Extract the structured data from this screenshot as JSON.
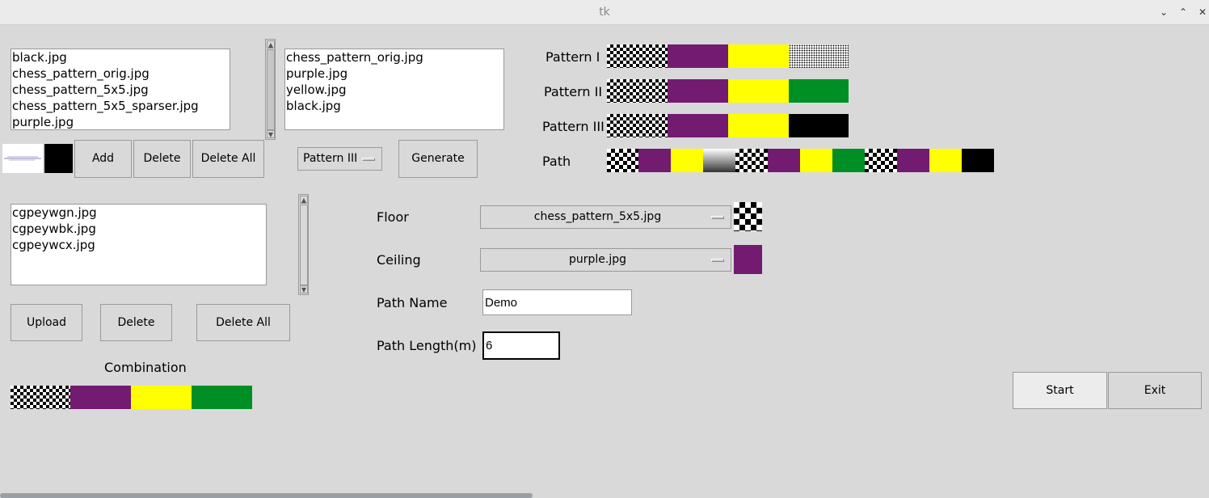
{
  "window": {
    "title": "tk",
    "controls": {
      "minimize_icon": "chevron-down-icon",
      "maximize_icon": "chevron-up-icon",
      "close_icon": "close-icon"
    }
  },
  "image_list": {
    "items": [
      "black.jpg",
      "chess_pattern_orig.jpg",
      "chess_pattern_5x5.jpg",
      "chess_pattern_5x5_sparser.jpg",
      "purple.jpg"
    ]
  },
  "selected_list": {
    "items": [
      "chess_pattern_orig.jpg",
      "purple.jpg",
      "yellow.jpg",
      "black.jpg"
    ]
  },
  "image_controls": {
    "add_label": "Add",
    "delete_label": "Delete",
    "delete_all_label": "Delete All"
  },
  "pattern_select": {
    "value": "Pattern III"
  },
  "generate_label": "Generate",
  "patterns": [
    {
      "label": "Pattern I",
      "swatches": [
        "chess-orig",
        "purple",
        "yellow",
        "dots"
      ]
    },
    {
      "label": "Pattern II",
      "swatches": [
        "chess-orig",
        "purple",
        "yellow",
        "green"
      ]
    },
    {
      "label": "Pattern III",
      "swatches": [
        "chess-orig",
        "purple",
        "yellow",
        "black"
      ]
    }
  ],
  "path": {
    "label": "Path",
    "swatches": [
      "chess",
      "purple",
      "yellow",
      "dots-fade",
      "chess",
      "purple",
      "yellow",
      "green",
      "chess",
      "purple",
      "yellow",
      "black"
    ]
  },
  "upload_list": {
    "items": [
      "cgpeywgn.jpg",
      "cgpeywbk.jpg",
      "cgpeywcx.jpg"
    ]
  },
  "upload_controls": {
    "upload_label": "Upload",
    "delete_label": "Delete",
    "delete_all_label": "Delete All"
  },
  "combination": {
    "label": "Combination",
    "swatches": [
      "chess-orig",
      "purple",
      "yellow",
      "green"
    ]
  },
  "floor": {
    "label": "Floor",
    "value": "chess_pattern_5x5.jpg",
    "preview": "chess-5x5"
  },
  "ceiling": {
    "label": "Ceiling",
    "value": "purple.jpg",
    "preview": "purple"
  },
  "path_name": {
    "label": "Path Name",
    "value": "Demo"
  },
  "path_length": {
    "label": "Path Length(m)",
    "value": "6"
  },
  "actions": {
    "start_label": "Start",
    "exit_label": "Exit"
  },
  "colors": {
    "purple": "#731b70",
    "yellow": "#ffff00",
    "green": "#008f24",
    "black": "#000000",
    "background": "#d9d9d9"
  }
}
